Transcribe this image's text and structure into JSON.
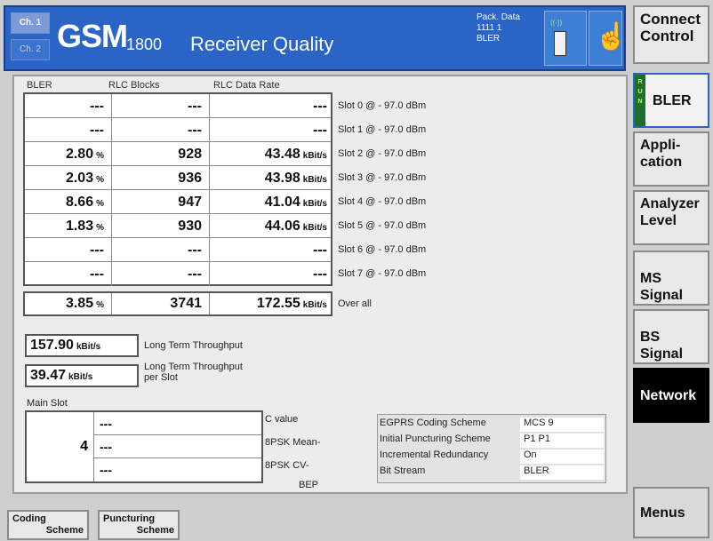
{
  "header": {
    "ch1_label": "Ch. 1",
    "ch2_label": "Ch. 2",
    "app_name": "GSM",
    "band": "1800",
    "subtitle": "Receiver Quality",
    "info_line1": "Pack. Data",
    "info_line2": "1111 1",
    "info_line3": "BLER",
    "status_icon": "phone-icon",
    "hand_icon": "hand-pointer-icon"
  },
  "softkeys": {
    "connect_control": "Connect Control",
    "bler": "BLER",
    "run": "RUN",
    "application": "Appli- cation",
    "analyzer_level": "Analyzer Level",
    "ms_signal": "MS Signal",
    "bs_signal": "BS Signal",
    "network": "Network",
    "menus": "Menus"
  },
  "table": {
    "col_bler": "BLER",
    "col_rlc_blocks": "RLC Blocks",
    "col_rlc_rate": "RLC Data Rate",
    "unit_pct": "%",
    "unit_rate": "kBit/s",
    "rows": [
      {
        "bler": "---",
        "blocks": "---",
        "rate": "---",
        "slot": "Slot 0 @  - 97.0  dBm"
      },
      {
        "bler": "---",
        "blocks": "---",
        "rate": "---",
        "slot": "Slot 1 @  - 97.0  dBm"
      },
      {
        "bler": "2.80",
        "blocks": "928",
        "rate": "43.48",
        "slot": "Slot 2 @  - 97.0  dBm"
      },
      {
        "bler": "2.03",
        "blocks": "936",
        "rate": "43.98",
        "slot": "Slot 3 @  - 97.0  dBm"
      },
      {
        "bler": "8.66",
        "blocks": "947",
        "rate": "41.04",
        "slot": "Slot 4 @  - 97.0  dBm"
      },
      {
        "bler": "1.83",
        "blocks": "930",
        "rate": "44.06",
        "slot": "Slot 5 @  - 97.0  dBm"
      },
      {
        "bler": "---",
        "blocks": "---",
        "rate": "---",
        "slot": "Slot 6 @  - 97.0  dBm"
      },
      {
        "bler": "---",
        "blocks": "---",
        "rate": "---",
        "slot": "Slot 7 @  - 97.0  dBm"
      }
    ],
    "overall": {
      "bler": "3.85",
      "blocks": "3741",
      "rate": "172.55",
      "label": "Over all"
    }
  },
  "throughput": {
    "long_term_value": "157.90",
    "long_term_label": "Long Term Throughput",
    "per_slot_value": "39.47",
    "per_slot_label_1": "Long Term Throughput",
    "per_slot_label_2": "per Slot"
  },
  "main_slot": {
    "label": "Main Slot",
    "number": "4",
    "c_value": "---",
    "bpsk_mean": "---",
    "bpsk_cv": "---",
    "c_value_label": "C value",
    "bpsk_mean_label": "8PSK Mean-",
    "bpsk_cv_label": "8PSK CV-",
    "bep_label": "BEP"
  },
  "egprs": {
    "rows": [
      {
        "key": "EGPRS Coding Scheme",
        "value": "MCS 9"
      },
      {
        "key": "Initial Puncturing Scheme",
        "value": "P1   P1"
      },
      {
        "key": "Incremental Redundancy",
        "value": "On"
      },
      {
        "key": "Bit Stream",
        "value": "BLER"
      }
    ]
  },
  "bottom_keys": {
    "coding_1": "Coding",
    "coding_2": "Scheme",
    "puncturing_1": "Puncturing",
    "puncturing_2": "Scheme"
  }
}
